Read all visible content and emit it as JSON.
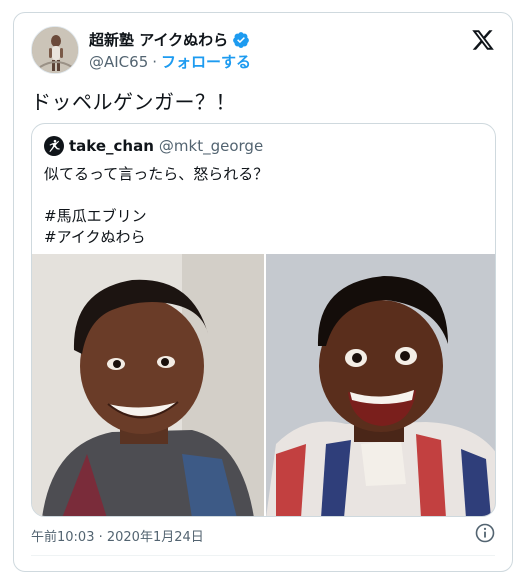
{
  "tweet": {
    "author": {
      "display_name": "超新塾 アイクぬわら",
      "handle": "@AIC65",
      "separator": "·",
      "follow_label": "フォローする",
      "verified": true,
      "avatar_icon": "user-avatar"
    },
    "text": "ドッペルゲンガー？！",
    "timestamp": "午前10:03 · 2020年1月24日",
    "brand_icon": "x-logo-icon"
  },
  "quoted_tweet": {
    "author": {
      "display_name": "take_chan",
      "handle": "@mkt_george"
    },
    "lines": [
      "似てるって言ったら、怒られる？",
      "",
      "#馬瓜エブリン",
      "#アイクぬわら"
    ],
    "media": [
      {
        "icon": "photo-person-left"
      },
      {
        "icon": "photo-person-right"
      }
    ]
  },
  "colors": {
    "accent": "#1d9bf0",
    "text": "#0f1419",
    "muted": "#536471",
    "border": "#cfd9de"
  }
}
